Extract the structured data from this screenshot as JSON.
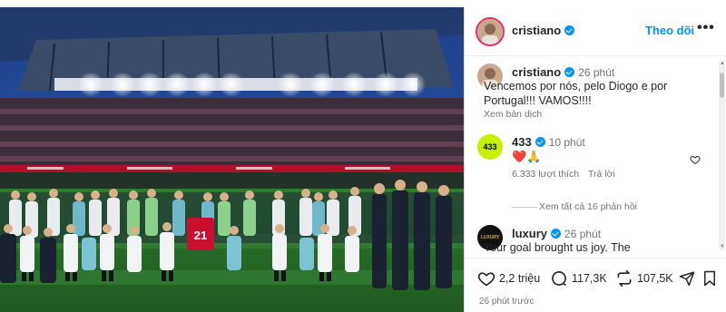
{
  "post": {
    "author": "cristiano",
    "follow_label": "Theo dõi",
    "more_label": "•••",
    "caption_author": "cristiano",
    "caption_time": "26 phút",
    "caption_text": "Vencemos por nós, pelo Diogo e por Portugal!!! VAMOS!!!!",
    "translate_label": "Xem bản dịch",
    "shirt_number": "21",
    "posted_ago": "26 phút trước"
  },
  "comments": [
    {
      "author": "433",
      "avatar_text": "433",
      "time": "10 phút",
      "text": "❤️🙏",
      "likes": "6.333 lượt thích",
      "reply_label": "Trả lời",
      "view_replies": "Xem tất cả 16 phản hồi"
    },
    {
      "author": "luxury",
      "avatar_text": "LUXURY",
      "time": "26 phút",
      "text": "Your goal brought us joy. The"
    }
  ],
  "actions": {
    "likes": "2,2 triệu",
    "comments": "117,3K",
    "reposts": "107,5K"
  },
  "colors": {
    "verified": "#0095f6",
    "follow": "#0095f6",
    "brand_433": "#c7f000",
    "heart": "#e0245e"
  }
}
